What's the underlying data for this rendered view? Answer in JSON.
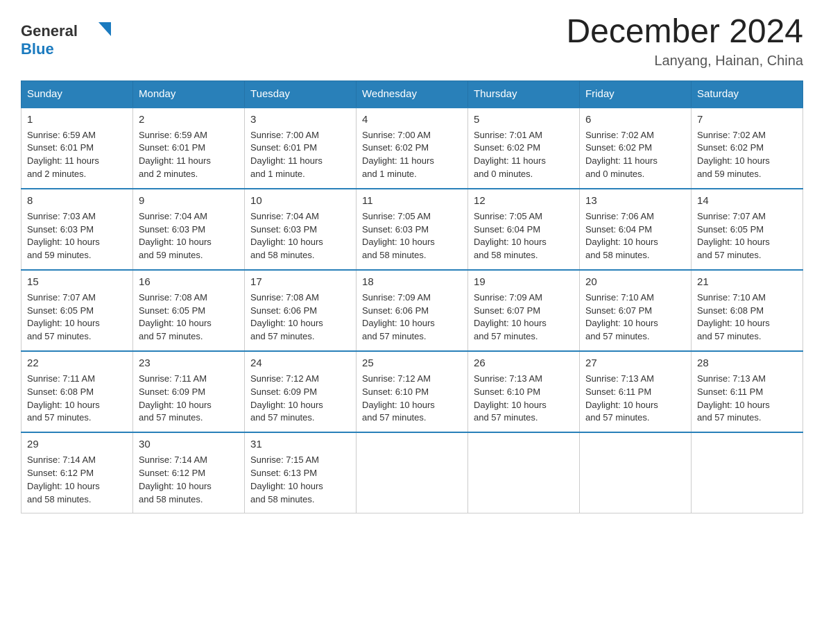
{
  "header": {
    "title": "December 2024",
    "subtitle": "Lanyang, Hainan, China",
    "logo_general": "General",
    "logo_blue": "Blue"
  },
  "days_of_week": [
    "Sunday",
    "Monday",
    "Tuesday",
    "Wednesday",
    "Thursday",
    "Friday",
    "Saturday"
  ],
  "weeks": [
    [
      {
        "num": "1",
        "sunrise": "6:59 AM",
        "sunset": "6:01 PM",
        "daylight": "11 hours and 2 minutes."
      },
      {
        "num": "2",
        "sunrise": "6:59 AM",
        "sunset": "6:01 PM",
        "daylight": "11 hours and 2 minutes."
      },
      {
        "num": "3",
        "sunrise": "7:00 AM",
        "sunset": "6:01 PM",
        "daylight": "11 hours and 1 minute."
      },
      {
        "num": "4",
        "sunrise": "7:00 AM",
        "sunset": "6:02 PM",
        "daylight": "11 hours and 1 minute."
      },
      {
        "num": "5",
        "sunrise": "7:01 AM",
        "sunset": "6:02 PM",
        "daylight": "11 hours and 0 minutes."
      },
      {
        "num": "6",
        "sunrise": "7:02 AM",
        "sunset": "6:02 PM",
        "daylight": "11 hours and 0 minutes."
      },
      {
        "num": "7",
        "sunrise": "7:02 AM",
        "sunset": "6:02 PM",
        "daylight": "10 hours and 59 minutes."
      }
    ],
    [
      {
        "num": "8",
        "sunrise": "7:03 AM",
        "sunset": "6:03 PM",
        "daylight": "10 hours and 59 minutes."
      },
      {
        "num": "9",
        "sunrise": "7:04 AM",
        "sunset": "6:03 PM",
        "daylight": "10 hours and 59 minutes."
      },
      {
        "num": "10",
        "sunrise": "7:04 AM",
        "sunset": "6:03 PM",
        "daylight": "10 hours and 58 minutes."
      },
      {
        "num": "11",
        "sunrise": "7:05 AM",
        "sunset": "6:03 PM",
        "daylight": "10 hours and 58 minutes."
      },
      {
        "num": "12",
        "sunrise": "7:05 AM",
        "sunset": "6:04 PM",
        "daylight": "10 hours and 58 minutes."
      },
      {
        "num": "13",
        "sunrise": "7:06 AM",
        "sunset": "6:04 PM",
        "daylight": "10 hours and 58 minutes."
      },
      {
        "num": "14",
        "sunrise": "7:07 AM",
        "sunset": "6:05 PM",
        "daylight": "10 hours and 57 minutes."
      }
    ],
    [
      {
        "num": "15",
        "sunrise": "7:07 AM",
        "sunset": "6:05 PM",
        "daylight": "10 hours and 57 minutes."
      },
      {
        "num": "16",
        "sunrise": "7:08 AM",
        "sunset": "6:05 PM",
        "daylight": "10 hours and 57 minutes."
      },
      {
        "num": "17",
        "sunrise": "7:08 AM",
        "sunset": "6:06 PM",
        "daylight": "10 hours and 57 minutes."
      },
      {
        "num": "18",
        "sunrise": "7:09 AM",
        "sunset": "6:06 PM",
        "daylight": "10 hours and 57 minutes."
      },
      {
        "num": "19",
        "sunrise": "7:09 AM",
        "sunset": "6:07 PM",
        "daylight": "10 hours and 57 minutes."
      },
      {
        "num": "20",
        "sunrise": "7:10 AM",
        "sunset": "6:07 PM",
        "daylight": "10 hours and 57 minutes."
      },
      {
        "num": "21",
        "sunrise": "7:10 AM",
        "sunset": "6:08 PM",
        "daylight": "10 hours and 57 minutes."
      }
    ],
    [
      {
        "num": "22",
        "sunrise": "7:11 AM",
        "sunset": "6:08 PM",
        "daylight": "10 hours and 57 minutes."
      },
      {
        "num": "23",
        "sunrise": "7:11 AM",
        "sunset": "6:09 PM",
        "daylight": "10 hours and 57 minutes."
      },
      {
        "num": "24",
        "sunrise": "7:12 AM",
        "sunset": "6:09 PM",
        "daylight": "10 hours and 57 minutes."
      },
      {
        "num": "25",
        "sunrise": "7:12 AM",
        "sunset": "6:10 PM",
        "daylight": "10 hours and 57 minutes."
      },
      {
        "num": "26",
        "sunrise": "7:13 AM",
        "sunset": "6:10 PM",
        "daylight": "10 hours and 57 minutes."
      },
      {
        "num": "27",
        "sunrise": "7:13 AM",
        "sunset": "6:11 PM",
        "daylight": "10 hours and 57 minutes."
      },
      {
        "num": "28",
        "sunrise": "7:13 AM",
        "sunset": "6:11 PM",
        "daylight": "10 hours and 57 minutes."
      }
    ],
    [
      {
        "num": "29",
        "sunrise": "7:14 AM",
        "sunset": "6:12 PM",
        "daylight": "10 hours and 58 minutes."
      },
      {
        "num": "30",
        "sunrise": "7:14 AM",
        "sunset": "6:12 PM",
        "daylight": "10 hours and 58 minutes."
      },
      {
        "num": "31",
        "sunrise": "7:15 AM",
        "sunset": "6:13 PM",
        "daylight": "10 hours and 58 minutes."
      },
      null,
      null,
      null,
      null
    ]
  ],
  "colors": {
    "header_bg": "#2980b9",
    "header_text": "#ffffff",
    "border_top": "#2980b9"
  },
  "labels": {
    "sunrise": "Sunrise:",
    "sunset": "Sunset:",
    "daylight": "Daylight:"
  }
}
